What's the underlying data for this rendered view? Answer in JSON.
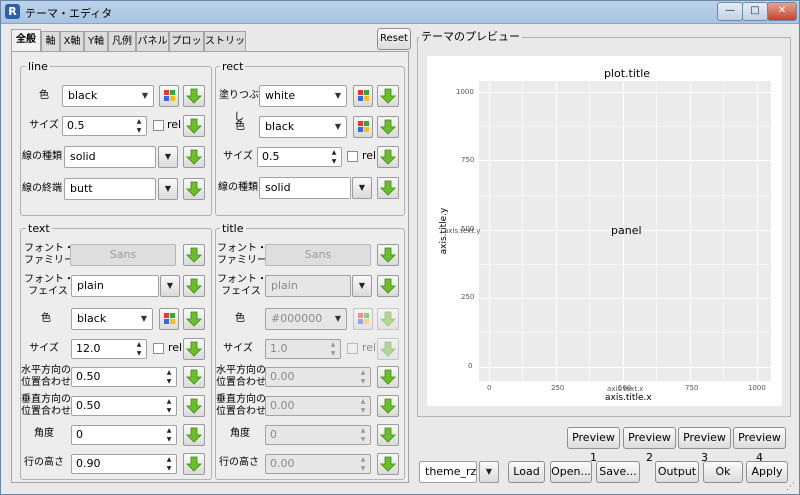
{
  "window": {
    "title": "テーマ・エディタ",
    "icon": "R",
    "minimize": "—",
    "maximize": "□",
    "close": "✕"
  },
  "tabs": [
    "全般",
    "軸",
    "X軸",
    "Y軸",
    "凡例",
    "パネル",
    "プロット",
    "ストリップ"
  ],
  "reset_label": "Reset",
  "line": {
    "group_label": "line",
    "color_label": "色",
    "color_value": "black",
    "size_label": "サイズ",
    "size_value": "0.5",
    "rel_label": "rel",
    "linetype_label": "線の種類",
    "linetype_value": "solid",
    "lineend_label": "線の終端",
    "lineend_value": "butt"
  },
  "rect": {
    "group_label": "rect",
    "fill_label": "塗りつぶし",
    "fill_value": "white",
    "color_label": "色",
    "color_value": "black",
    "size_label": "サイズ",
    "size_value": "0.5",
    "rel_label": "rel",
    "linetype_label": "線の種類",
    "linetype_value": "solid"
  },
  "text": {
    "group_label": "text",
    "family_label": "フォント・\nファミリー",
    "family_value": "Sans",
    "face_label": "フォント・\nフェイス",
    "face_value": "plain",
    "color_label": "色",
    "color_value": "black",
    "size_label": "サイズ",
    "size_value": "12.0",
    "rel_label": "rel",
    "hjust_label": "水平方向の\n位置合わせ",
    "hjust_value": "0.50",
    "vjust_label": "垂直方向の\n位置合わせ",
    "vjust_value": "0.50",
    "angle_label": "角度",
    "angle_value": "0",
    "lineheight_label": "行の高さ",
    "lineheight_value": "0.90"
  },
  "title": {
    "group_label": "title",
    "family_label": "フォント・\nファミリー",
    "family_value": "Sans",
    "face_label": "フォント・\nフェイス",
    "face_value": "plain",
    "color_label": "色",
    "color_value": "#000000",
    "size_label": "サイズ",
    "size_value": "1.0",
    "rel_label": "rel",
    "hjust_label": "水平方向の\n位置合わせ",
    "hjust_value": "0.00",
    "vjust_label": "垂直方向の\n位置合わせ",
    "vjust_value": "0.00",
    "angle_label": "角度",
    "angle_value": "0",
    "lineheight_label": "行の高さ",
    "lineheight_value": "0.00"
  },
  "preview": {
    "group_label": "テーマのプレビュー",
    "plot_title": "plot.title",
    "panel_label": "panel",
    "axis_title_x": "axis.title.x",
    "axis_title_y": "axis.title.y",
    "axis_text_x": "axis.text.x",
    "axis_text_y": "axis.text.y",
    "y_ticks": [
      "1000",
      "750",
      "500",
      "250",
      "0"
    ],
    "x_ticks": [
      "0",
      "250",
      "500",
      "750",
      "1000"
    ],
    "buttons": [
      "Preview 1",
      "Preview 2",
      "Preview 3",
      "Preview 4"
    ]
  },
  "bottom": {
    "theme_value": "theme_rz",
    "load": "Load",
    "open": "Open...",
    "save": "Save...",
    "output": "Output",
    "ok": "Ok",
    "apply": "Apply"
  },
  "colors": {
    "accent_green": "#6cbf2a",
    "titlebar": "#a7c3e0"
  }
}
